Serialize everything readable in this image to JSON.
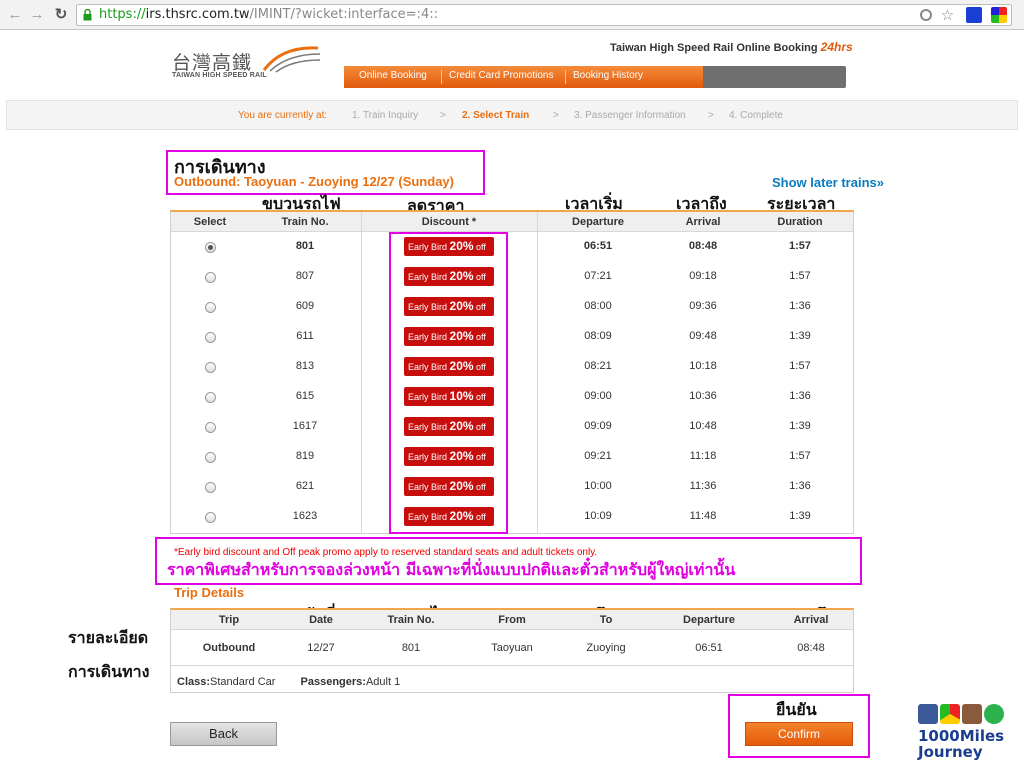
{
  "browser": {
    "url_scheme": "https://",
    "url_host": "irs.thsrc.com.tw",
    "url_path": "/IMINT/?wicket:interface=:4::"
  },
  "header": {
    "logo_cn": "台灣高鐵",
    "logo_en": "TAIWAN HIGH SPEED RAIL",
    "brand_text": "Taiwan High Speed Rail Online Booking",
    "brand_24": "24hrs",
    "menu": [
      "Online Booking",
      "Credit Card Promotions",
      "Booking History"
    ]
  },
  "steps": {
    "prefix": "You are currently at:",
    "items": [
      "1. Train Inquiry",
      "2. Select Train",
      "3. Passenger Information",
      "4. Complete"
    ],
    "separator": ">"
  },
  "annotations": {
    "trip_title": "การเดินทาง",
    "train_no": "ขบวนรถไฟ",
    "discount": "ลดราคา",
    "departure": "เวลาเริ่ม",
    "arrival": "เวลาถึง",
    "duration": "ระยะเวลา",
    "note_th": "ราคาพิเศษสำหรับการจองล่วงหน้า  มีเฉพาะที่นั่งแบบปกติและตั๋วสำหรับผู้ใหญ่เท่านั้น",
    "details_l1": "รายละเอียด",
    "details_l2": "การเดินทาง",
    "date": "วันที่",
    "train_no2": "ขบวนรถไฟ",
    "from": "จาก",
    "to": "ถึง",
    "depart": "เวลาออก",
    "arrive": "เวลาถึง",
    "confirm": "ยืนยัน"
  },
  "outbound": {
    "title": "Outbound: Taoyuan - Zuoying 12/27 (Sunday)",
    "later": "Show later trains»",
    "headers": {
      "select": "Select",
      "train_no": "Train No.",
      "discount": "Discount *",
      "departure": "Departure",
      "arrival": "Arrival",
      "duration": "Duration"
    },
    "badge_prefix": "Early Bird",
    "badge_suffix": "off",
    "rows": [
      {
        "train": "801",
        "discount": "20%",
        "dep": "06:51",
        "arr": "08:48",
        "dur": "1:57",
        "selected": true
      },
      {
        "train": "807",
        "discount": "20%",
        "dep": "07:21",
        "arr": "09:18",
        "dur": "1:57",
        "selected": false
      },
      {
        "train": "609",
        "discount": "20%",
        "dep": "08:00",
        "arr": "09:36",
        "dur": "1:36",
        "selected": false
      },
      {
        "train": "611",
        "discount": "20%",
        "dep": "08:09",
        "arr": "09:48",
        "dur": "1:39",
        "selected": false
      },
      {
        "train": "813",
        "discount": "20%",
        "dep": "08:21",
        "arr": "10:18",
        "dur": "1:57",
        "selected": false
      },
      {
        "train": "615",
        "discount": "10%",
        "dep": "09:00",
        "arr": "10:36",
        "dur": "1:36",
        "selected": false
      },
      {
        "train": "1617",
        "discount": "20%",
        "dep": "09:09",
        "arr": "10:48",
        "dur": "1:39",
        "selected": false
      },
      {
        "train": "819",
        "discount": "20%",
        "dep": "09:21",
        "arr": "11:18",
        "dur": "1:57",
        "selected": false
      },
      {
        "train": "621",
        "discount": "20%",
        "dep": "10:00",
        "arr": "11:36",
        "dur": "1:36",
        "selected": false
      },
      {
        "train": "1623",
        "discount": "20%",
        "dep": "10:09",
        "arr": "11:48",
        "dur": "1:39",
        "selected": false
      }
    ]
  },
  "note": "*Early bird discount and Off peak promo apply to reserved standard seats and adult tickets only.",
  "trip_details": {
    "title": "Trip Details",
    "headers": [
      "Trip",
      "Date",
      "Train No.",
      "From",
      "To",
      "Departure",
      "Arrival"
    ],
    "row": [
      "Outbound",
      "12/27",
      "801",
      "Taoyuan",
      "Zuoying",
      "06:51",
      "08:48"
    ],
    "class_label": "Class:",
    "class_value": "Standard Car",
    "pass_label": "Passengers:",
    "pass_value": "Adult 1"
  },
  "buttons": {
    "back": "Back",
    "confirm": "Confirm"
  },
  "watermark": {
    "line1": "1000Miles",
    "line2": "Journey"
  },
  "colors": {
    "accent": "#e96f10",
    "badge": "#c80d0d",
    "highlight": "#e400e4",
    "link": "#0a7bbd"
  }
}
